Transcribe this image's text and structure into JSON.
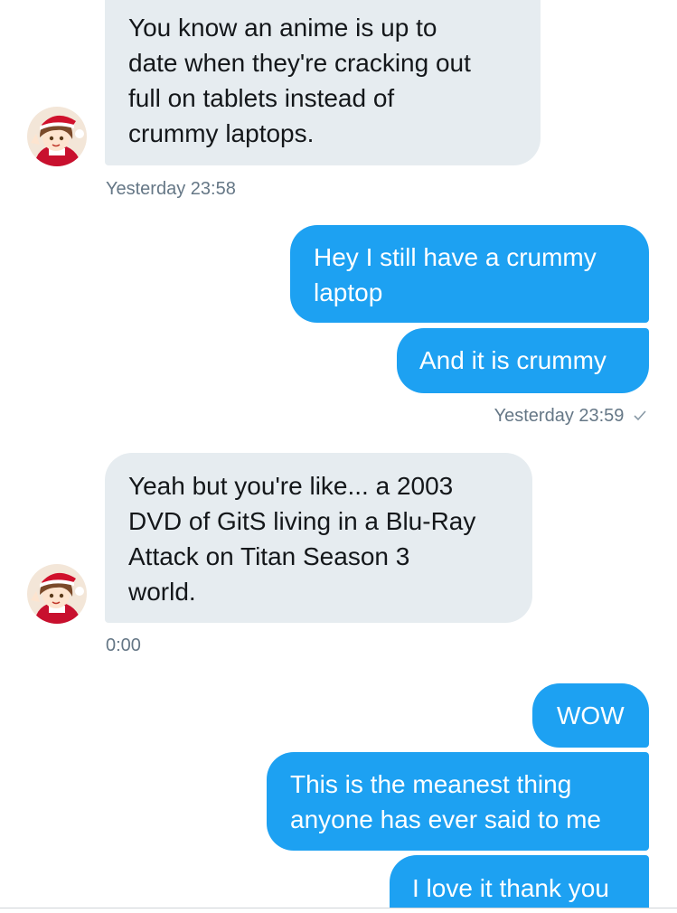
{
  "messages": [
    {
      "direction": "received",
      "lines": [
        "You know an anime is up to",
        "date when they're cracking out",
        "full on tablets instead of",
        "crummy laptops."
      ],
      "timestamp": "Yesterday 23:58"
    },
    {
      "direction": "sent",
      "lines": [
        "Hey I still have a crummy",
        "laptop"
      ]
    },
    {
      "direction": "sent",
      "lines": [
        "And it is crummy"
      ],
      "timestamp": "Yesterday 23:59",
      "read_receipt": "checkmark-icon"
    },
    {
      "direction": "received",
      "lines": [
        "Yeah but you're like... a 2003",
        "DVD of GitS living in a Blu-Ray",
        "Attack on Titan Season 3",
        "world."
      ],
      "timestamp": "0:00"
    },
    {
      "direction": "sent",
      "lines": [
        "WOW"
      ]
    },
    {
      "direction": "sent",
      "lines": [
        "This is the meanest thing",
        "anyone has ever said to me"
      ]
    },
    {
      "direction": "sent",
      "lines": [
        "I love it thank you"
      ]
    }
  ],
  "colors": {
    "sent_bubble": "#1da1f2",
    "received_bubble": "#e6ecf0",
    "timestamp": "#657786"
  },
  "avatar": {
    "icon": "anime-avatar-icon"
  }
}
